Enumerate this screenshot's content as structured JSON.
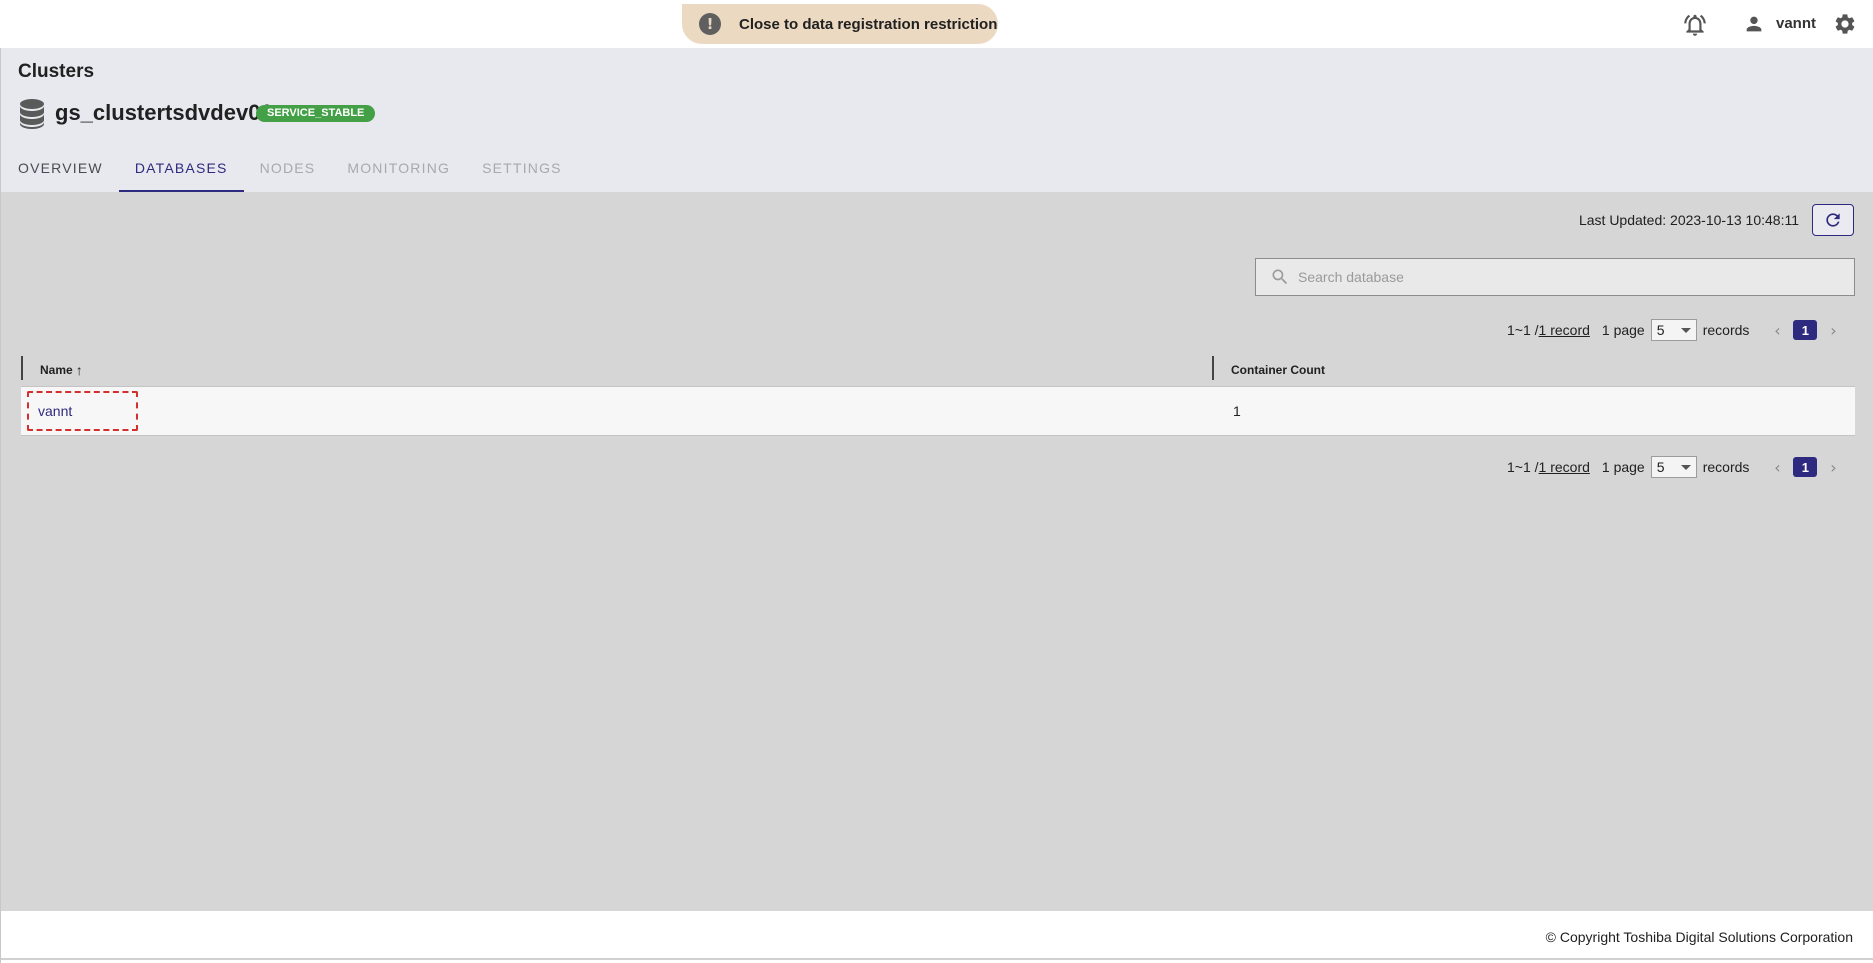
{
  "topbar": {
    "alert_icon_glyph": "!",
    "alert_text": "Close to data registration restriction",
    "username": "vannt",
    "icons": [
      "bell-alert-icon",
      "user-icon",
      "gear-icon"
    ]
  },
  "header": {
    "title": "Clusters",
    "cluster_name": "gs_clustertsdvdev01",
    "status": "SERVICE_STABLE",
    "status_color": "#43a047",
    "tabs": [
      {
        "label": "OVERVIEW"
      },
      {
        "label": "DATABASES"
      },
      {
        "label": "NODES"
      },
      {
        "label": "MONITORING"
      },
      {
        "label": "SETTINGS"
      }
    ],
    "active_tab": "DATABASES"
  },
  "main": {
    "last_updated": "Last Updated: 2023-10-13 10:48:11",
    "search": {
      "placeholder": "Search database",
      "value": ""
    },
    "pagination": {
      "range": "1~1 / ",
      "record_link": "1 record",
      "pages": "1 page",
      "page_size": "5",
      "records_label": "records",
      "current_page": "1"
    },
    "table": {
      "columns": [
        "Name",
        "Container Count"
      ],
      "sort_indicator": "↑",
      "rows": [
        {
          "name": "vannt",
          "container_count": "1"
        }
      ]
    }
  },
  "footer": {
    "copyright": "© Copyright Toshiba Digital Solutions Corporation"
  },
  "colors": {
    "accent": "#2e2a7f",
    "alert_bg": "#ebd9c1",
    "content_bg": "#d6d6d6",
    "header_bg": "#e8e9ee",
    "highlight_border": "#d32f2f"
  }
}
